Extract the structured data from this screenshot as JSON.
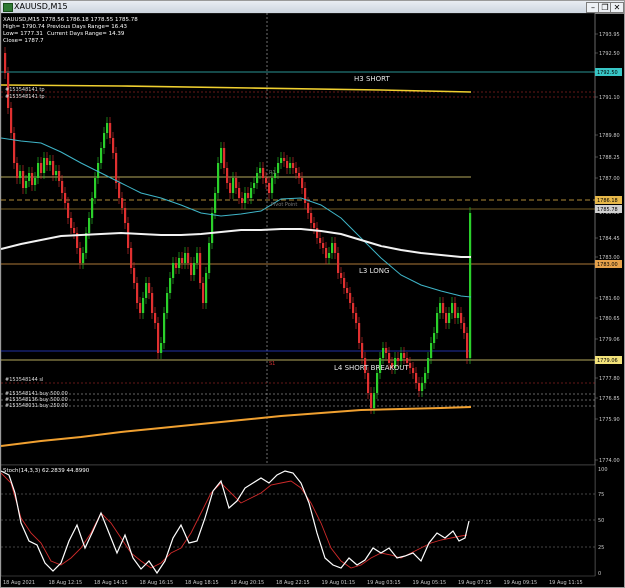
{
  "window": {
    "title": "XAUUSD,M15",
    "buttons": [
      "–",
      "❐",
      "✕"
    ]
  },
  "info": {
    "line1a": "High= 1790.74",
    "line1b": "Previous Days Range= 16.43",
    "line2a": "Low= 1777.31",
    "line2b": "Current Days Range= 14.39",
    "line3": "Close= 1787.7",
    "symbol_line": "XAUUSD,M15  1778.56 1786.18 1778.55 1785.78",
    "order1": "#153548141 tp",
    "order2": "#153548141 tp",
    "order3": "#153548144 sl",
    "order4": "#153548141 buy 500.00",
    "order5": "#153548136 buy 500.00",
    "order6": "#153548031 buy 250.00"
  },
  "levels": {
    "h3": "H3 SHORT",
    "l3": "L3 LONG",
    "l4": "L4 SHORT BREAKOUT",
    "pivot": "Pivot Point",
    "r1": "R1",
    "s1": "S1"
  },
  "price_axis": [
    "1793.95",
    "1792.50",
    "1791.10",
    "1789.80",
    "1788.25",
    "1787.00",
    "1785.50",
    "1784.45",
    "1783.00",
    "1781.60",
    "1780.65",
    "1779.06",
    "1777.80",
    "1776.85",
    "1775.90",
    "1774.00"
  ],
  "price_tags": {
    "t1": {
      "label": "1792.50",
      "color": "#38c6c6"
    },
    "t2": {
      "label": "1786.18",
      "color": "#e7b84a"
    },
    "t3": {
      "label": "1785.78",
      "color": "#d0d0d0"
    },
    "t4": {
      "label": "1783.00",
      "color": "#e6a14a"
    },
    "t5": {
      "label": "1779.06",
      "color": "#f2e27a"
    }
  },
  "stoch": {
    "label": "Stoch(14,3,3) 62.2839 44.8990",
    "levels": [
      "100",
      "75",
      "50",
      "25",
      "0"
    ]
  },
  "time_axis": [
    "18 Aug 2021",
    "18 Aug 12:15",
    "18 Aug 14:15",
    "18 Aug 16:15",
    "18 Aug 18:15",
    "18 Aug 20:15",
    "18 Aug 22:15",
    "19 Aug 01:15",
    "19 Aug 03:15",
    "19 Aug 05:15",
    "19 Aug 07:15",
    "19 Aug 09:15",
    "19 Aug 11:15"
  ],
  "colors": {
    "bull": "#2bd02b",
    "bear": "#e03030",
    "ma_fast": "#3fb6c9",
    "ma_slow": "#f2f2f2",
    "ma_long": "#f0a030",
    "stoch_main": "#ffffff",
    "stoch_signal": "#d02a2a"
  }
}
